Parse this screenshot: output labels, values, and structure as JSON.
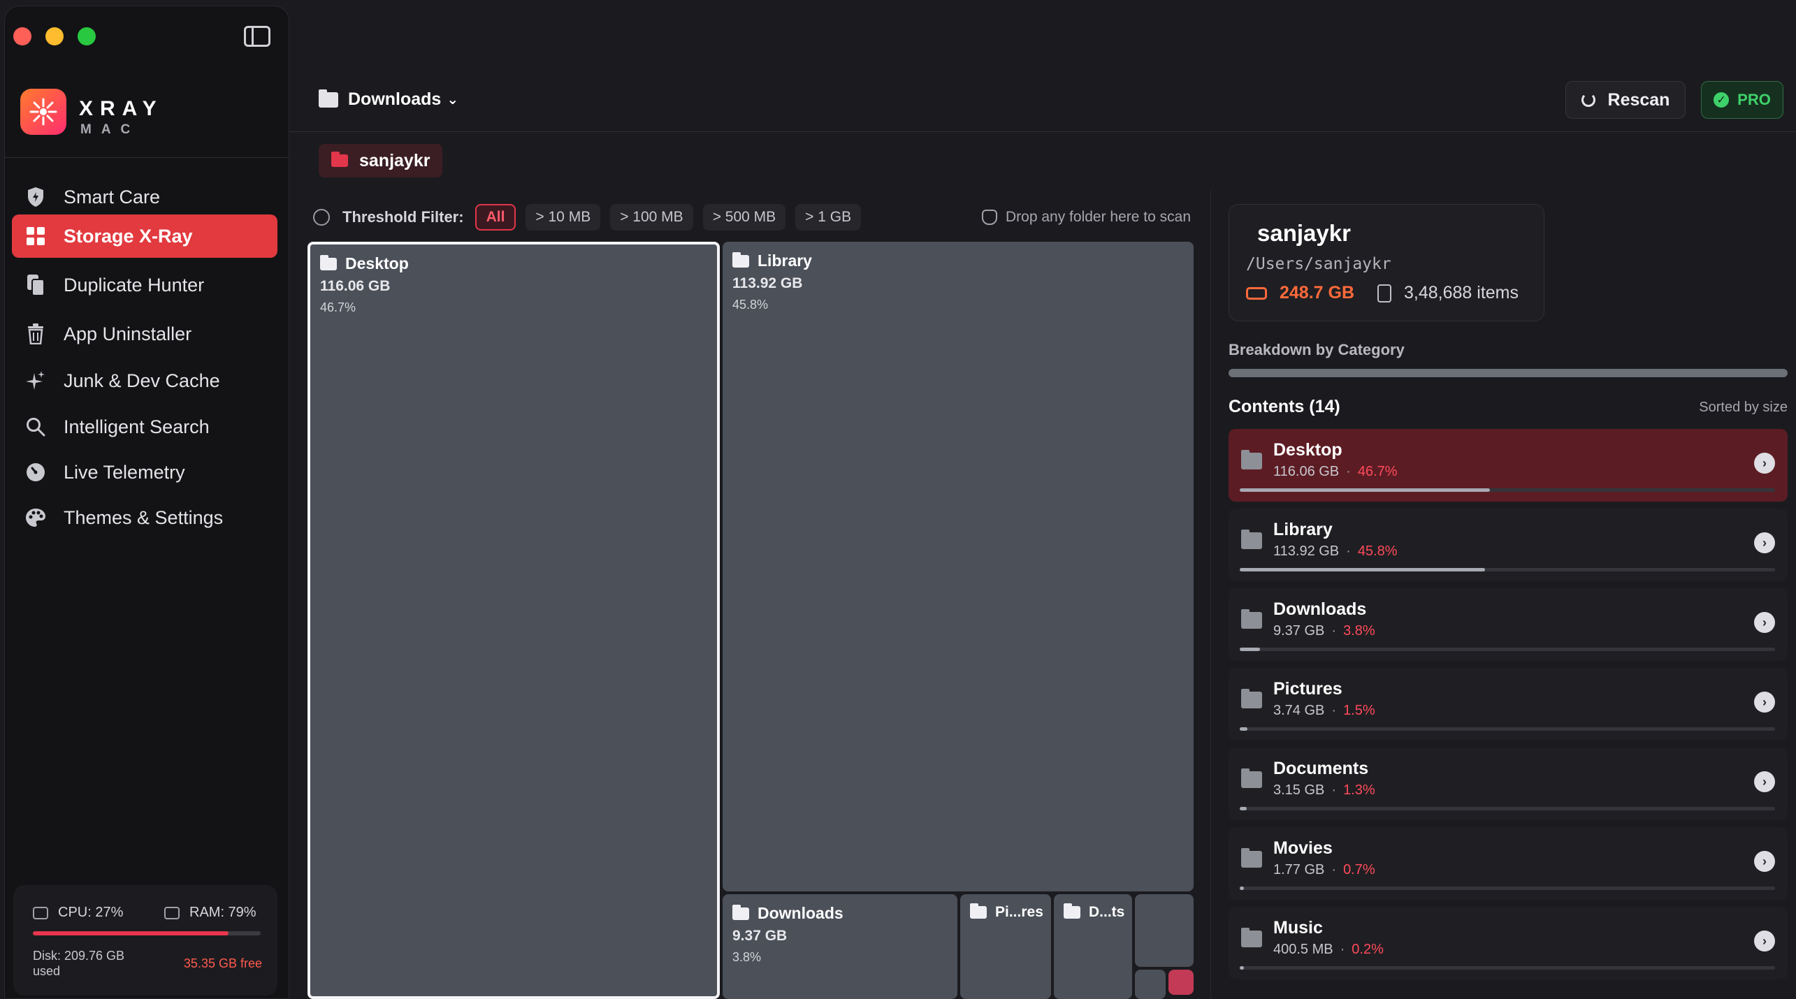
{
  "sidebar": {
    "brand_title": "XRAY",
    "brand_sub": "MAC",
    "items": [
      {
        "label": "Smart Care",
        "icon": "shield-icon"
      },
      {
        "label": "Storage X-Ray",
        "icon": "grid-icon"
      },
      {
        "label": "Duplicate Hunter",
        "icon": "files-icon"
      },
      {
        "label": "App Uninstaller",
        "icon": "trash-icon"
      },
      {
        "label": "Junk & Dev Cache",
        "icon": "sparkle-icon"
      },
      {
        "label": "Intelligent Search",
        "icon": "search-icon"
      },
      {
        "label": "Live Telemetry",
        "icon": "gauge-icon"
      },
      {
        "label": "Themes & Settings",
        "icon": "palette-icon"
      }
    ],
    "active_index": 1,
    "stats": {
      "cpu": "CPU: 27%",
      "ram": "RAM: 79%",
      "disk_used": "Disk: 209.76 GB used",
      "disk_free": "35.35 GB free",
      "disk_used_fraction": 0.86
    }
  },
  "header": {
    "title": "Downloads",
    "rescan_label": "Rescan",
    "pro_label": "PRO"
  },
  "breadcrumb": {
    "label": "sanjaykr"
  },
  "filter": {
    "label": "Threshold Filter:",
    "chips": [
      "All",
      "> 10 MB",
      "> 100 MB",
      "> 500 MB",
      "> 1 GB"
    ],
    "active_index": 0,
    "drop_hint": "Drop any folder here to scan"
  },
  "treemap": {
    "tiles": [
      {
        "name": "Desktop",
        "size": "116.06 GB",
        "pct": "46.7%"
      },
      {
        "name": "Library",
        "size": "113.92 GB",
        "pct": "45.8%"
      },
      {
        "name": "Downloads",
        "size": "9.37 GB",
        "pct": "3.8%"
      },
      {
        "name": "Pi...res"
      },
      {
        "name": "D...ts"
      }
    ]
  },
  "info": {
    "name": "sanjaykr",
    "path": "/Users/sanjaykr",
    "total_size": "248.7 GB",
    "items": "3,48,688 items"
  },
  "panel": {
    "breakdown_label": "Breakdown by Category",
    "contents_title": "Contents (14)",
    "sorted_label": "Sorted by size",
    "rows": [
      {
        "name": "Desktop",
        "size": "116.06 GB",
        "pct": "46.7%",
        "fraction": 0.467
      },
      {
        "name": "Library",
        "size": "113.92 GB",
        "pct": "45.8%",
        "fraction": 0.458
      },
      {
        "name": "Downloads",
        "size": "9.37 GB",
        "pct": "3.8%",
        "fraction": 0.038
      },
      {
        "name": "Pictures",
        "size": "3.74 GB",
        "pct": "1.5%",
        "fraction": 0.015
      },
      {
        "name": "Documents",
        "size": "3.15 GB",
        "pct": "1.3%",
        "fraction": 0.013
      },
      {
        "name": "Movies",
        "size": "1.77 GB",
        "pct": "0.7%",
        "fraction": 0.007
      },
      {
        "name": "Music",
        "size": "400.5 MB",
        "pct": "0.2%",
        "fraction": 0.002
      }
    ]
  }
}
